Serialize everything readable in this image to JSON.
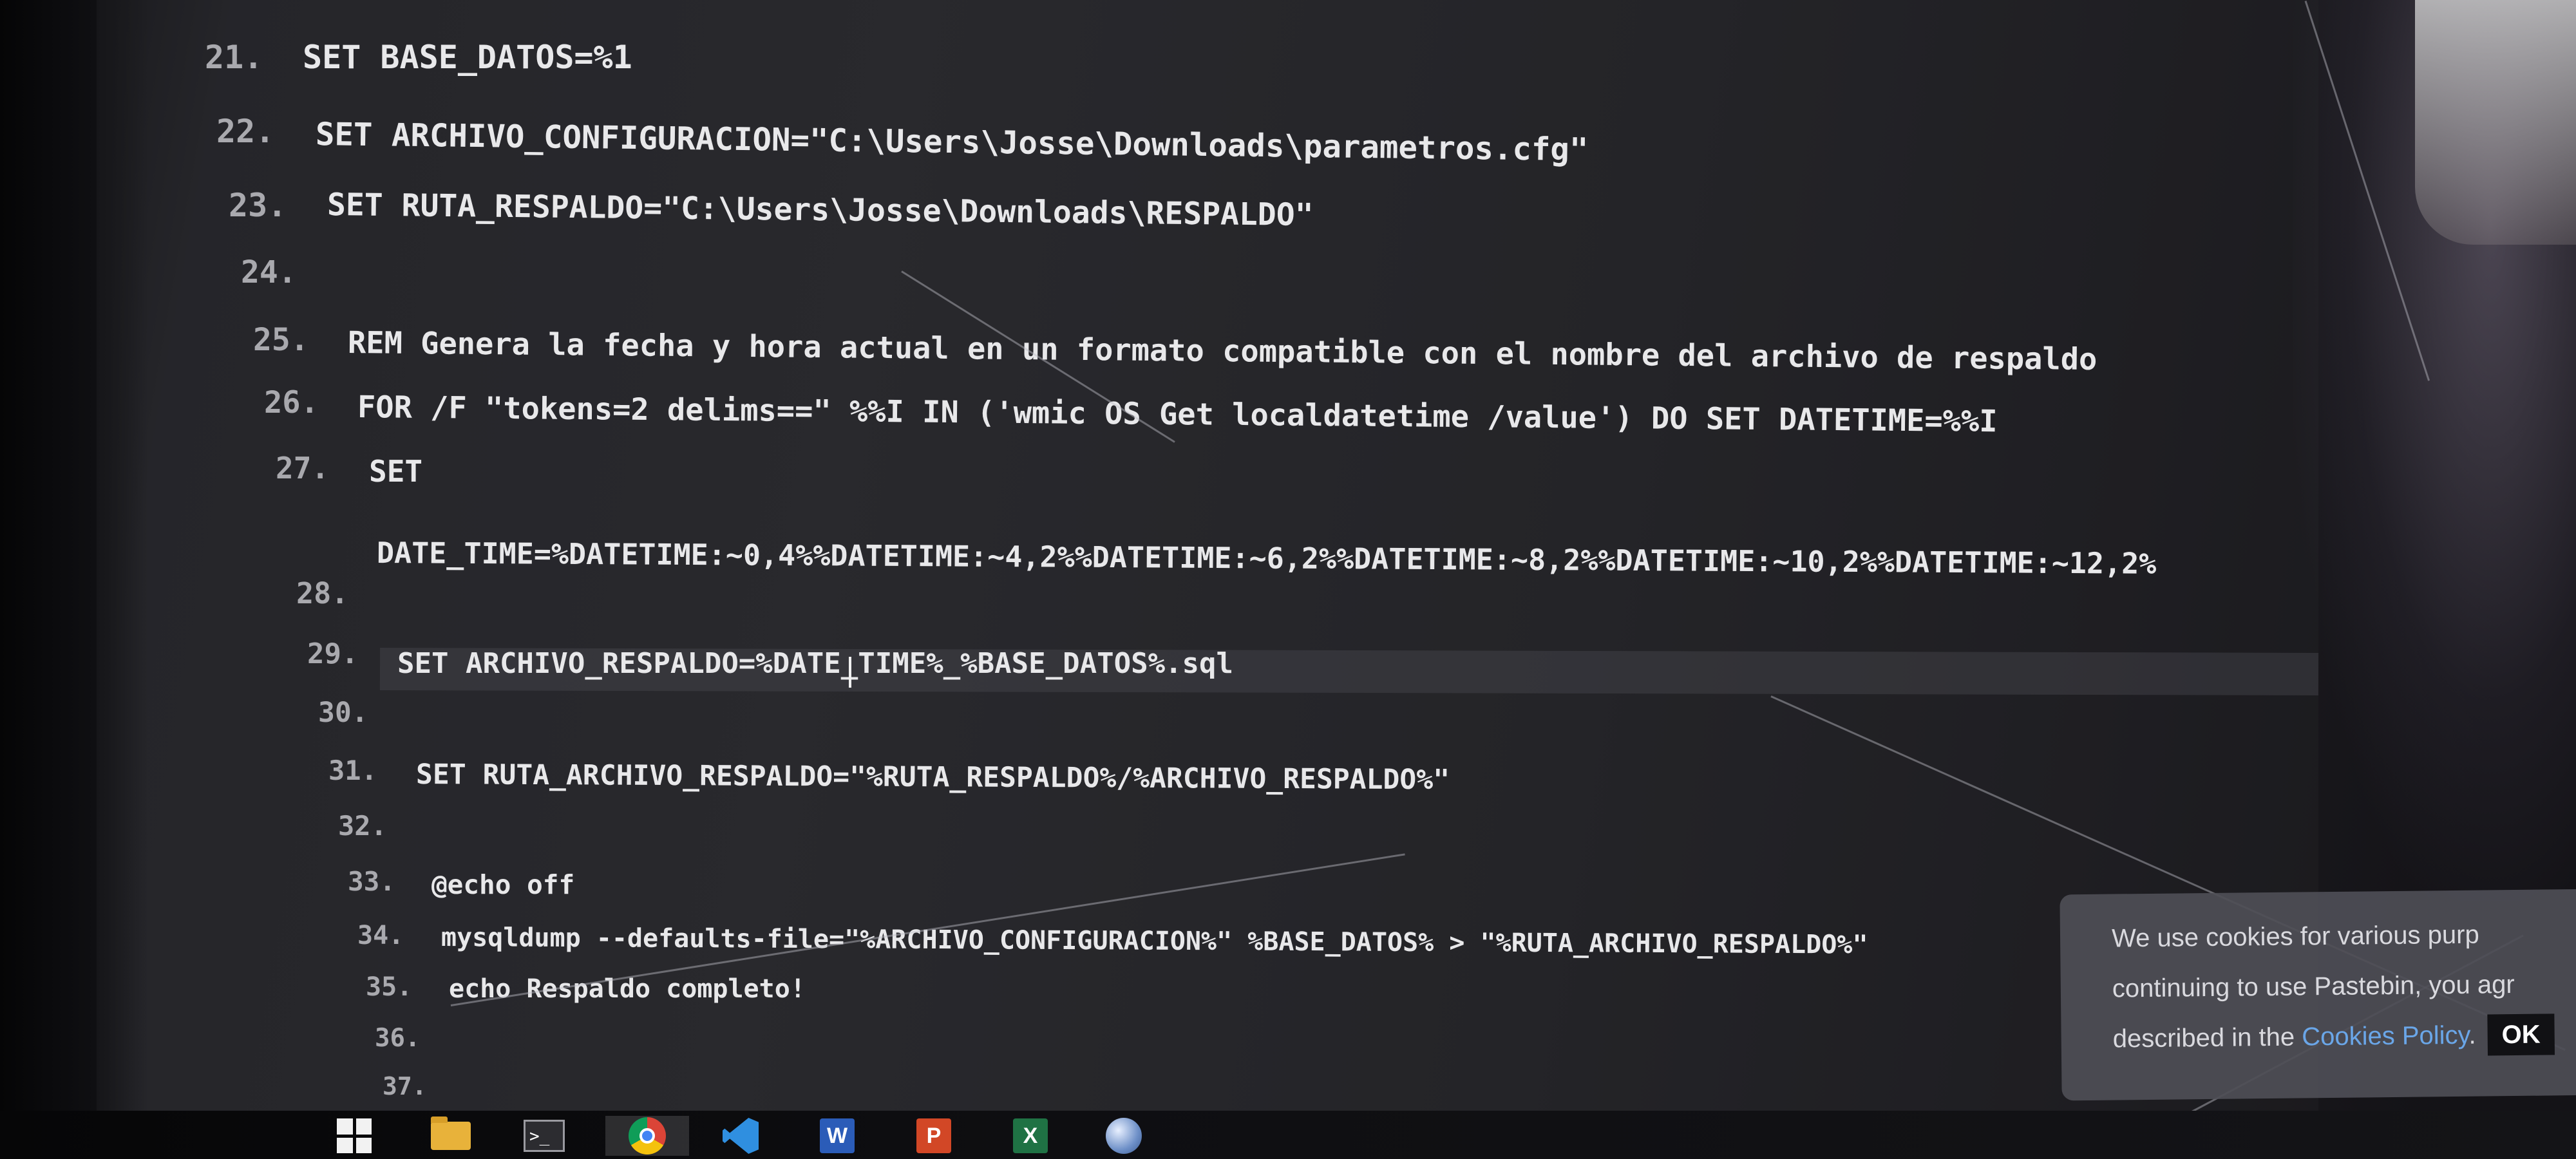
{
  "editor": {
    "lines": [
      {
        "num": "21.",
        "code": "SET BASE_DATOS=%1"
      },
      {
        "num": "22.",
        "code": "SET ARCHIVO_CONFIGURACION=\"C:\\Users\\Josse\\Downloads\\parametros.cfg\""
      },
      {
        "num": "23.",
        "code": "SET RUTA_RESPALDO=\"C:\\Users\\Josse\\Downloads\\RESPALDO\""
      },
      {
        "num": "24.",
        "code": ""
      },
      {
        "num": "25.",
        "code": "REM Genera la fecha y hora actual en un formato compatible con el nombre del archivo de respaldo"
      },
      {
        "num": "26.",
        "code": "FOR /F \"tokens=2 delims==\" %%I IN ('wmic OS Get localdatetime /value') DO SET DATETIME=%%I"
      },
      {
        "num": "27.",
        "code": "SET"
      },
      {
        "num": "",
        "code": "DATE_TIME=%DATETIME:~0,4%%DATETIME:~4,2%%DATETIME:~6,2%%DATETIME:~8,2%%DATETIME:~10,2%%DATETIME:~12,2%"
      },
      {
        "num": "28.",
        "code": ""
      },
      {
        "num": "29.",
        "code": "SET ARCHIVO_RESPALDO=%DATE_TIME%_%BASE_DATOS%.sql"
      },
      {
        "num": "30.",
        "code": ""
      },
      {
        "num": "31.",
        "code": "SET RUTA_ARCHIVO_RESPALDO=\"%RUTA_RESPALDO%/%ARCHIVO_RESPALDO%\""
      },
      {
        "num": "32.",
        "code": ""
      },
      {
        "num": "33.",
        "code": "@echo off"
      },
      {
        "num": "34.",
        "code": "mysqldump --defaults-file=\"%ARCHIVO_CONFIGURACION%\" %BASE_DATOS% > \"%RUTA_ARCHIVO_RESPALDO%\""
      },
      {
        "num": "35.",
        "code": "echo Respaldo completo!"
      },
      {
        "num": "36.",
        "code": ""
      },
      {
        "num": "37.",
        "code": ""
      }
    ]
  },
  "cookie_banner": {
    "line1": "We use cookies for various purp",
    "line2": "continuing to use Pastebin, you agr",
    "line3_prefix": "described in the ",
    "link": "Cookies Policy",
    "line3_suffix": ".",
    "ok_label": "OK"
  },
  "taskbar": {
    "icons": [
      "windows-start-icon",
      "file-explorer-icon",
      "terminal-icon",
      "chrome-icon",
      "vscode-icon",
      "word-icon",
      "powerpoint-icon",
      "excel-icon",
      "globe-icon"
    ]
  }
}
